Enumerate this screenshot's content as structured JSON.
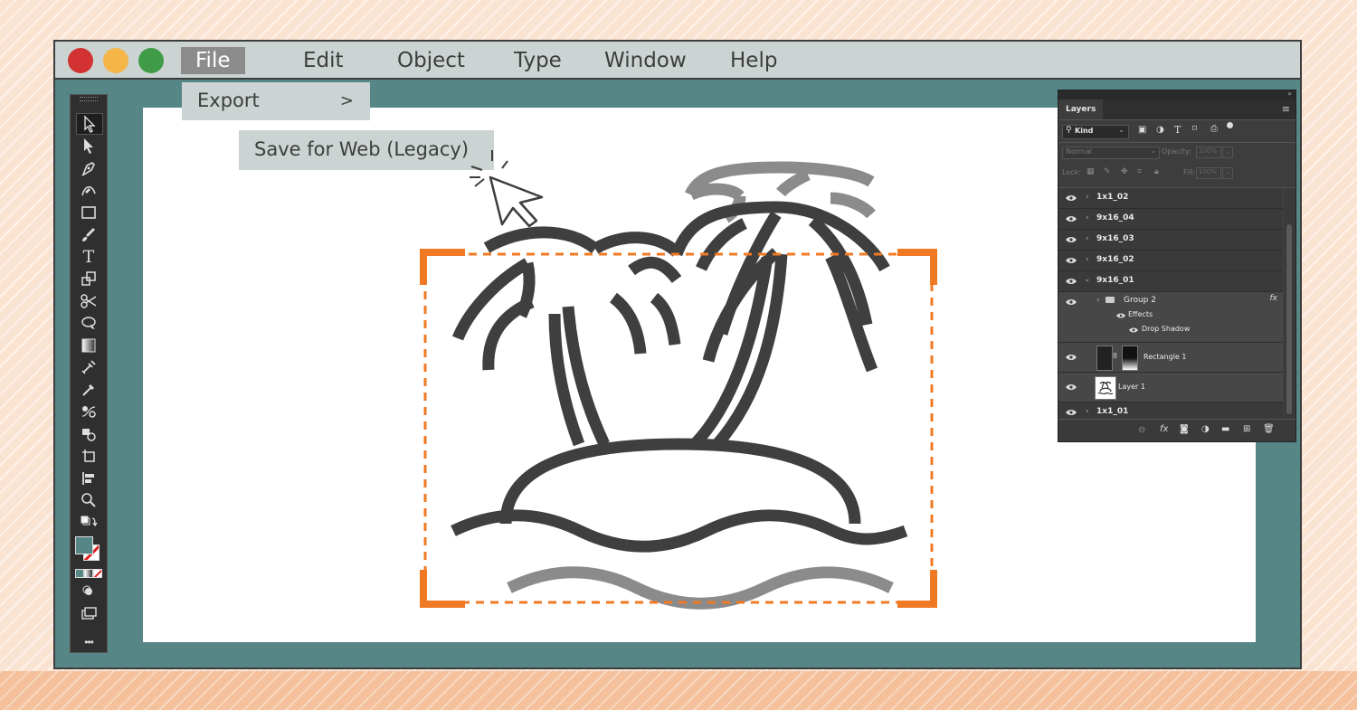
{
  "menubar": {
    "items": [
      {
        "label": "File",
        "active": true
      },
      {
        "label": "Edit"
      },
      {
        "label": "Object"
      },
      {
        "label": "Type"
      },
      {
        "label": "Window"
      },
      {
        "label": "Help"
      }
    ],
    "traffic_lights": {
      "close": "#d33232",
      "minimize": "#f5b548",
      "maximize": "#3f9b45"
    }
  },
  "file_menu": {
    "export": {
      "label": "Export",
      "arrow": ">"
    },
    "submenu": {
      "save_for_web": "Save for Web (Legacy)"
    }
  },
  "colors": {
    "window_bg": "#568686",
    "menubar_bg": "#cbd4d3",
    "artwork_dark": "#3f3f3f",
    "artwork_gray": "#8b8b8b",
    "selection_orange": "#f07a24"
  },
  "toolbar": {
    "tools": [
      "selection-tool-icon",
      "direct-selection-tool-icon",
      "pen-tool-icon",
      "curvature-tool-icon",
      "rectangle-tool-icon",
      "paintbrush-tool-icon",
      "type-tool-icon",
      "scale-tool-icon",
      "scissors-tool-icon",
      "puppet-warp-tool-icon",
      "gradient-tool-icon",
      "eyedropper-alt-tool-icon",
      "eyedropper-tool-icon",
      "blend-tool-icon",
      "shape-builder-tool-icon",
      "artboard-tool-icon",
      "align-tool-icon",
      "zoom-tool-icon"
    ],
    "more_label": "•••"
  },
  "layers_panel": {
    "tab_label": "Layers",
    "filter_label": "Kind",
    "blend_mode": "Normal",
    "opacity_label": "Opacity:",
    "opacity_value": "100%",
    "lock_label": "Lock:",
    "fill_label": "Fill:",
    "fill_value": "100%",
    "rows": [
      {
        "name": "1x1_02"
      },
      {
        "name": "9x16_04"
      },
      {
        "name": "9x16_03"
      },
      {
        "name": "9x16_02"
      },
      {
        "name": "9x16_01"
      },
      {
        "name": "Group 2",
        "fx": "fx"
      },
      {
        "name": "Effects"
      },
      {
        "name": "Drop Shadow"
      },
      {
        "name": "Rectangle 1"
      },
      {
        "name": "Layer 1"
      },
      {
        "name": "1x1_01"
      }
    ],
    "footer_fx": "fx"
  }
}
